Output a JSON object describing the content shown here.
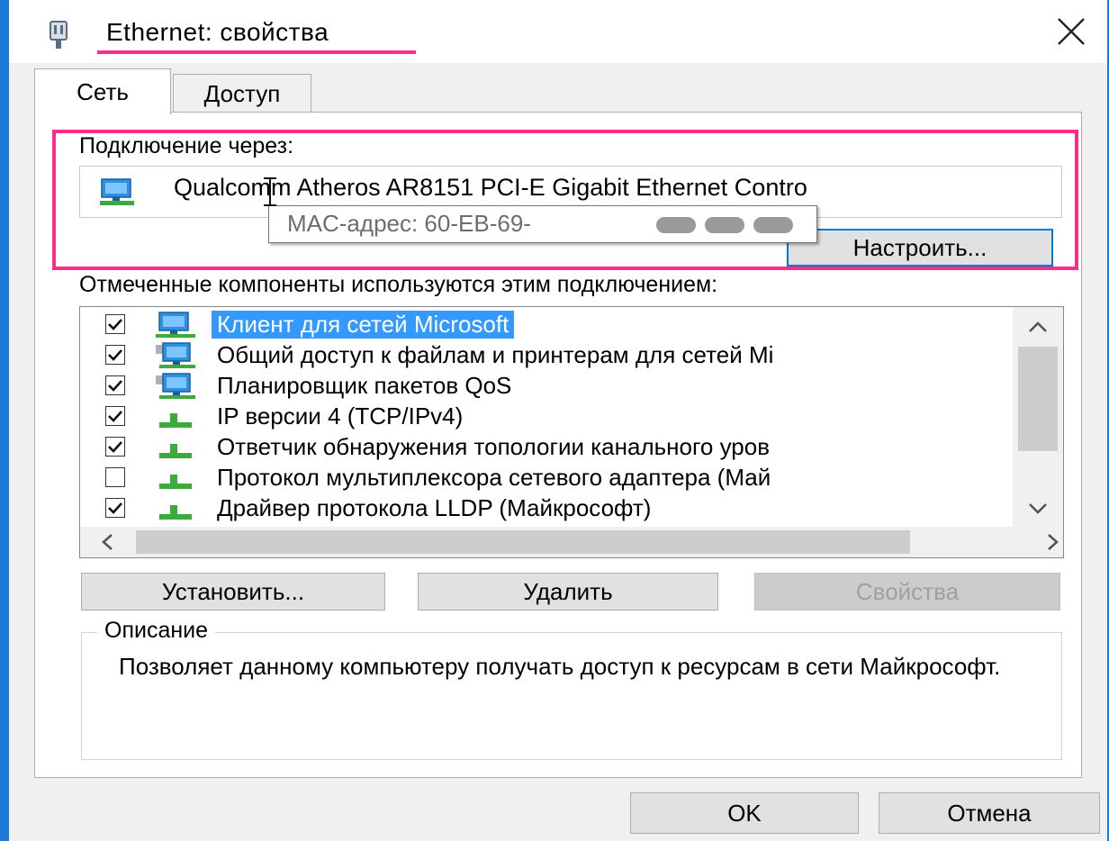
{
  "window": {
    "title": "Ethernet: свойства",
    "close_symbol": "✕",
    "accent_color": "#1e7ad6",
    "annotation_color": "#ff2d8a"
  },
  "tabs": [
    {
      "label": "Сеть",
      "active": true
    },
    {
      "label": "Доступ",
      "active": false
    }
  ],
  "connection": {
    "label": "Подключение через:",
    "adapter_name": "Qualcomm Atheros AR8151 PCI-E Gigabit Ethernet Contro",
    "tooltip": "MAC-адрес: 60-EB-69-",
    "configure_label": "Настроить..."
  },
  "components": {
    "label": "Отмеченные компоненты используются этим подключением:",
    "items": [
      {
        "label": "Клиент для сетей Microsoft",
        "checked": true,
        "selected": true,
        "icon": "network-client-icon"
      },
      {
        "label": "Общий доступ к файлам и принтерам для сетей Mi",
        "checked": true,
        "selected": false,
        "icon": "network-service-icon"
      },
      {
        "label": "Планировщик пакетов QoS",
        "checked": true,
        "selected": false,
        "icon": "network-service-icon"
      },
      {
        "label": "IP версии 4 (TCP/IPv4)",
        "checked": true,
        "selected": false,
        "icon": "protocol-icon"
      },
      {
        "label": "Ответчик обнаружения топологии канального уров",
        "checked": true,
        "selected": false,
        "icon": "protocol-icon"
      },
      {
        "label": "Протокол мультиплексора сетевого адаптера (Май",
        "checked": false,
        "selected": false,
        "icon": "protocol-icon"
      },
      {
        "label": "Драйвер протокола LLDP (Майкрософт)",
        "checked": true,
        "selected": false,
        "icon": "protocol-icon"
      }
    ]
  },
  "buttons": {
    "install": "Установить...",
    "remove": "Удалить",
    "properties": "Свойства",
    "ok": "OK",
    "cancel": "Отмена"
  },
  "description": {
    "legend": "Описание",
    "text": "Позволяет данному компьютеру получать доступ к ресурсам в сети Майкрософт."
  }
}
